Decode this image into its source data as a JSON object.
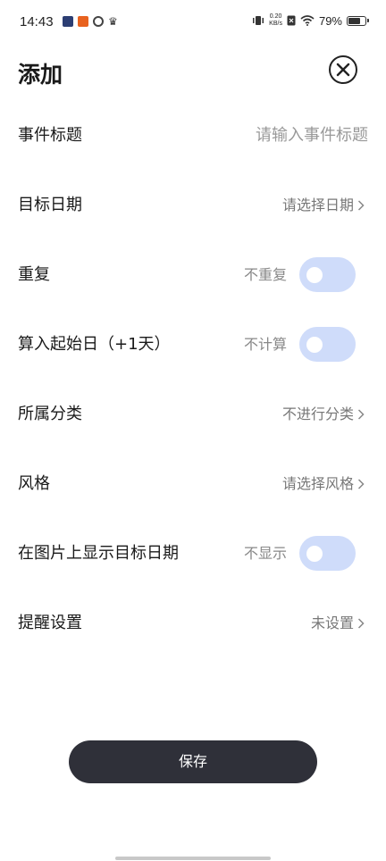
{
  "status_bar": {
    "time": "14:43",
    "net_speed_value": "0.20",
    "net_speed_unit": "KB/s",
    "battery_percent": "79%",
    "battery_level": 0.79
  },
  "header": {
    "title": "添加"
  },
  "form": {
    "title": {
      "label": "事件标题",
      "placeholder": "请输入事件标题"
    },
    "target_date": {
      "label": "目标日期",
      "value": "请选择日期"
    },
    "repeat": {
      "label": "重复",
      "value": "不重复",
      "on": false
    },
    "include_start": {
      "label": "算入起始日（+1天）",
      "value": "不计算",
      "on": false
    },
    "category": {
      "label": "所属分类",
      "value": "不进行分类"
    },
    "style": {
      "label": "风格",
      "value": "请选择风格"
    },
    "show_on_image": {
      "label": "在图片上显示目标日期",
      "value": "不显示",
      "on": false
    },
    "reminder": {
      "label": "提醒设置",
      "value": "未设置"
    }
  },
  "actions": {
    "save_label": "保存"
  },
  "colors": {
    "toggle_off": "#cfdcfa",
    "save_button": "#2f3039"
  }
}
